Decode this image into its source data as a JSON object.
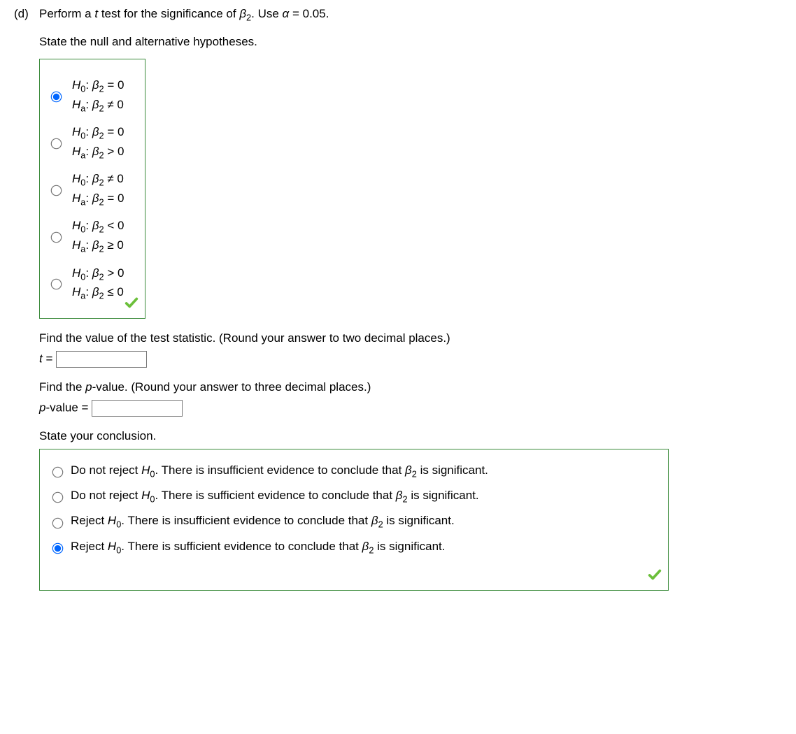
{
  "part_label": "(d)",
  "prompt_prefix": "Perform a ",
  "prompt_var": "t",
  "prompt_mid": " test for the significance of ",
  "prompt_beta": "β",
  "prompt_sub": "2",
  "prompt_after": ". Use ",
  "prompt_alpha": "α",
  "prompt_eq": " = 0.05.",
  "state_hyp": "State the null and alternative hypotheses.",
  "H": "H",
  "sub0": "0",
  "suba": "a",
  "colon": ": ",
  "beta": "β",
  "sub2": "2",
  "eq0": " = 0",
  "ne0": " ≠ 0",
  "gt0": " > 0",
  "lt0": " < 0",
  "ge0": " ≥ 0",
  "le0": " ≤ 0",
  "find_t": "Find the value of the test statistic. (Round your answer to two decimal places.)",
  "t_label_var": "t",
  "t_label_eq": " = ",
  "find_p": "Find the ",
  "p_ital": "p",
  "find_p2": "-value. (Round your answer to three decimal places.)",
  "p_label_p": "p",
  "p_label_rest": "-value = ",
  "state_conc": "State your conclusion.",
  "conc": {
    "dnr": "Do not reject ",
    "rej": "Reject ",
    "H": "H",
    "sub0": "0",
    "dot": ". ",
    "insuf": "There is insufficient evidence to conclude that ",
    "suf": "There is sufficient evidence to conclude that ",
    "beta": "β",
    "sub2": "2",
    "sig": " is significant."
  }
}
